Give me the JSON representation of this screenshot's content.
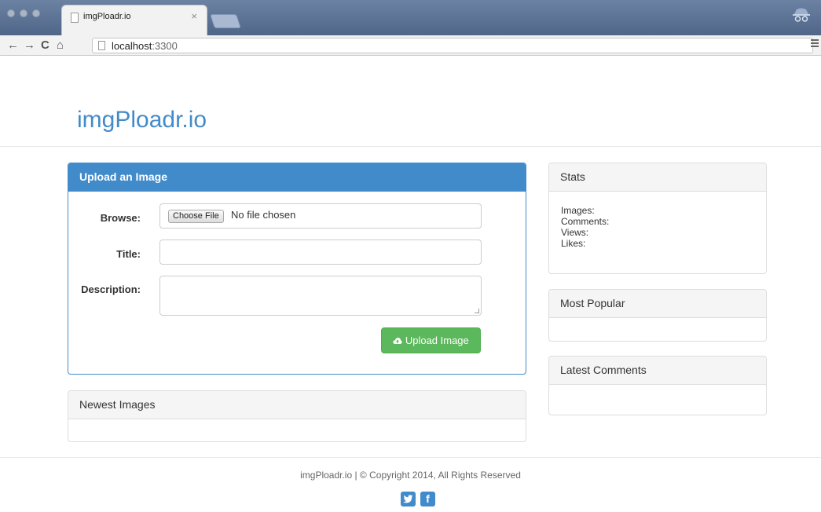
{
  "browser": {
    "tab_title": "imgPloadr.io",
    "tab_close": "×",
    "url_host": "localhost",
    "url_port": ":3300",
    "nav": {
      "back": "←",
      "forward": "→",
      "reload": "C",
      "home": "⌂"
    }
  },
  "site": {
    "brand": "imgPloadr.io"
  },
  "upload_panel": {
    "heading": "Upload an Image",
    "browse_label": "Browse:",
    "file_button": "Choose File",
    "file_status": "No file chosen",
    "title_label": "Title:",
    "title_value": "",
    "description_label": "Description:",
    "description_value": "",
    "submit_icon": "cloud-upload-icon",
    "submit_label": "Upload Image"
  },
  "newest_panel": {
    "heading": "Newest Images"
  },
  "stats_panel": {
    "heading": "Stats",
    "images_label": "Images:",
    "comments_label": "Comments:",
    "views_label": "Views:",
    "likes_label": "Likes:"
  },
  "popular_panel": {
    "heading": "Most Popular"
  },
  "comments_panel": {
    "heading": "Latest Comments"
  },
  "footer": {
    "text": "imgPloadr.io | © Copyright 2014, All Rights Reserved",
    "twitter_icon": "twitter-icon",
    "facebook_icon": "facebook-icon"
  },
  "colors": {
    "primary": "#428bca",
    "success": "#5cb85c"
  }
}
